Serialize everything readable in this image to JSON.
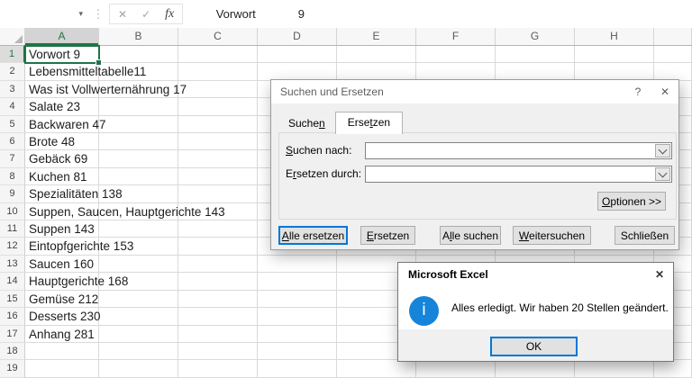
{
  "colors": {
    "excel_green": "#217346",
    "focus_blue": "#0078d7",
    "info_blue": "#1684d9"
  },
  "formula_bar": {
    "name_box_value": "",
    "dropdown_icon": "▾",
    "cancel_icon": "✕",
    "enter_icon": "✓",
    "fx_label": "fx",
    "cell_text": "Vorwort",
    "cell_number": "9"
  },
  "grid": {
    "column_headers": [
      "A",
      "B",
      "C",
      "D",
      "E",
      "F",
      "G",
      "H",
      ""
    ],
    "active_column": "A",
    "rows": [
      {
        "n": "1",
        "text": "Vorwort 9",
        "selected": true
      },
      {
        "n": "2",
        "text": "Lebensmitteltabelle11"
      },
      {
        "n": "3",
        "text": "Was ist Vollwerternährung 17"
      },
      {
        "n": "4",
        "text": "Salate 23"
      },
      {
        "n": "5",
        "text": "Backwaren 47"
      },
      {
        "n": "6",
        "text": "Brote 48"
      },
      {
        "n": "7",
        "text": "Gebäck 69"
      },
      {
        "n": "8",
        "text": "Kuchen 81"
      },
      {
        "n": "9",
        "text": "Spezialitäten 138"
      },
      {
        "n": "10",
        "text": "Suppen, Saucen, Hauptgerichte 143"
      },
      {
        "n": "11",
        "text": "Suppen 143"
      },
      {
        "n": "12",
        "text": "Eintopfgerichte 153"
      },
      {
        "n": "13",
        "text": "Saucen 160"
      },
      {
        "n": "14",
        "text": "Hauptgerichte 168"
      },
      {
        "n": "15",
        "text": "Gemüse 212"
      },
      {
        "n": "16",
        "text": "Desserts 230"
      },
      {
        "n": "17",
        "text": "Anhang 281"
      },
      {
        "n": "18",
        "text": ""
      },
      {
        "n": "19",
        "text": ""
      }
    ]
  },
  "find_replace_dialog": {
    "title": "Suchen und Ersetzen",
    "help_icon": "?",
    "close_icon": "✕",
    "tabs": {
      "suchen": {
        "pre": "Suche",
        "accel": "n",
        "post": ""
      },
      "ersetzen": {
        "pre": "Erse",
        "accel": "t",
        "post": "zen"
      }
    },
    "fields": {
      "search_label": {
        "pre": "",
        "accel": "S",
        "post": "uchen nach:"
      },
      "replace_label": {
        "pre": "E",
        "accel": "r",
        "post": "setzen durch:"
      },
      "search_value": "",
      "replace_value": ""
    },
    "buttons": {
      "options": {
        "pre": "",
        "accel": "O",
        "post": "ptionen >>"
      },
      "replace_all": {
        "pre": "",
        "accel": "A",
        "post": "lle ersetzen"
      },
      "replace": {
        "pre": "",
        "accel": "E",
        "post": "rsetzen"
      },
      "find_all": {
        "pre": "A",
        "accel": "l",
        "post": "le suchen"
      },
      "find_next": {
        "pre": "",
        "accel": "W",
        "post": "eitersuchen"
      },
      "close": {
        "pre": "",
        "accel": "",
        "post": "Schließen"
      }
    }
  },
  "message_dialog": {
    "title": "Microsoft Excel",
    "close_icon": "✕",
    "info_icon": "i",
    "message": "Alles erledigt. Wir haben 20 Stellen geändert.",
    "ok_label": "OK"
  }
}
